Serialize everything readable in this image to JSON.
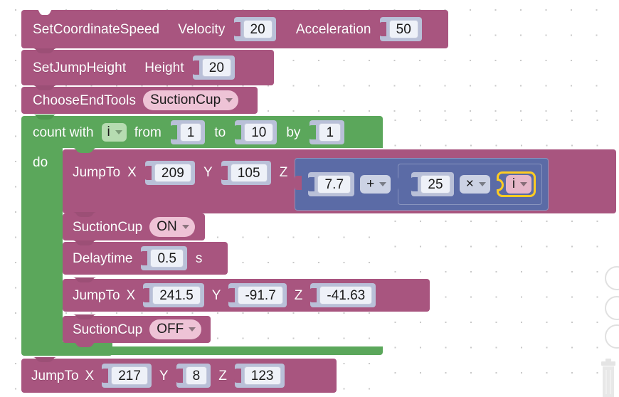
{
  "workspace": {
    "name": "blockly-workspace",
    "background": "#ffffff",
    "grid_dot_color": "#c9c9c9",
    "colors": {
      "command_block": "#a8557f",
      "loop_block": "#5ba75b",
      "math_block": "#5b6ba6",
      "field_socket": "#b9c0d8",
      "field_input": "#eef1f8",
      "dropdown_pink": "#eec3d6",
      "highlight": "#ffcc22"
    }
  },
  "blocks": {
    "set_coordinate_speed": {
      "name": "SetCoordinateSpeed",
      "param1_label": "Velocity",
      "param1_value": "20",
      "param2_label": "Acceleration",
      "param2_value": "50"
    },
    "set_jump_height": {
      "name": "SetJumpHeight",
      "param1_label": "Height",
      "param1_value": "20"
    },
    "choose_end_tools": {
      "name": "ChooseEndTools",
      "dropdown_value": "SuctionCup"
    },
    "count_loop": {
      "label_count_with": "count with",
      "variable": "i",
      "label_from": "from",
      "from_value": "1",
      "label_to": "to",
      "to_value": "10",
      "label_by": "by",
      "by_value": "1",
      "label_do": "do"
    },
    "jump_to_1": {
      "name": "JumpTo",
      "x_label": "X",
      "x_value": "209",
      "y_label": "Y",
      "y_value": "105",
      "z_label": "Z",
      "z_expression": {
        "operand_a": "7.7",
        "operator_outer": "+",
        "inner": {
          "operand_a": "25",
          "operator": "×",
          "operand_b_variable": "i"
        }
      }
    },
    "suction_cup_on": {
      "name": "SuctionCup",
      "dropdown_value": "ON"
    },
    "delaytime": {
      "name": "Delaytime",
      "value": "0.5",
      "unit": "s"
    },
    "jump_to_2": {
      "name": "JumpTo",
      "x_label": "X",
      "x_value": "241.5",
      "y_label": "Y",
      "y_value": "-91.7",
      "z_label": "Z",
      "z_value": "-41.63"
    },
    "suction_cup_off": {
      "name": "SuctionCup",
      "dropdown_value": "OFF"
    },
    "jump_to_3": {
      "name": "JumpTo",
      "x_label": "X",
      "x_value": "217",
      "y_label": "Y",
      "y_value": "8",
      "z_label": "Z",
      "z_value": "123"
    }
  },
  "controls": {
    "zoom_in_icon": "zoom-in-icon",
    "zoom_out_icon": "zoom-out-icon",
    "center_icon": "center-icon",
    "trash_icon": "trash-icon"
  }
}
